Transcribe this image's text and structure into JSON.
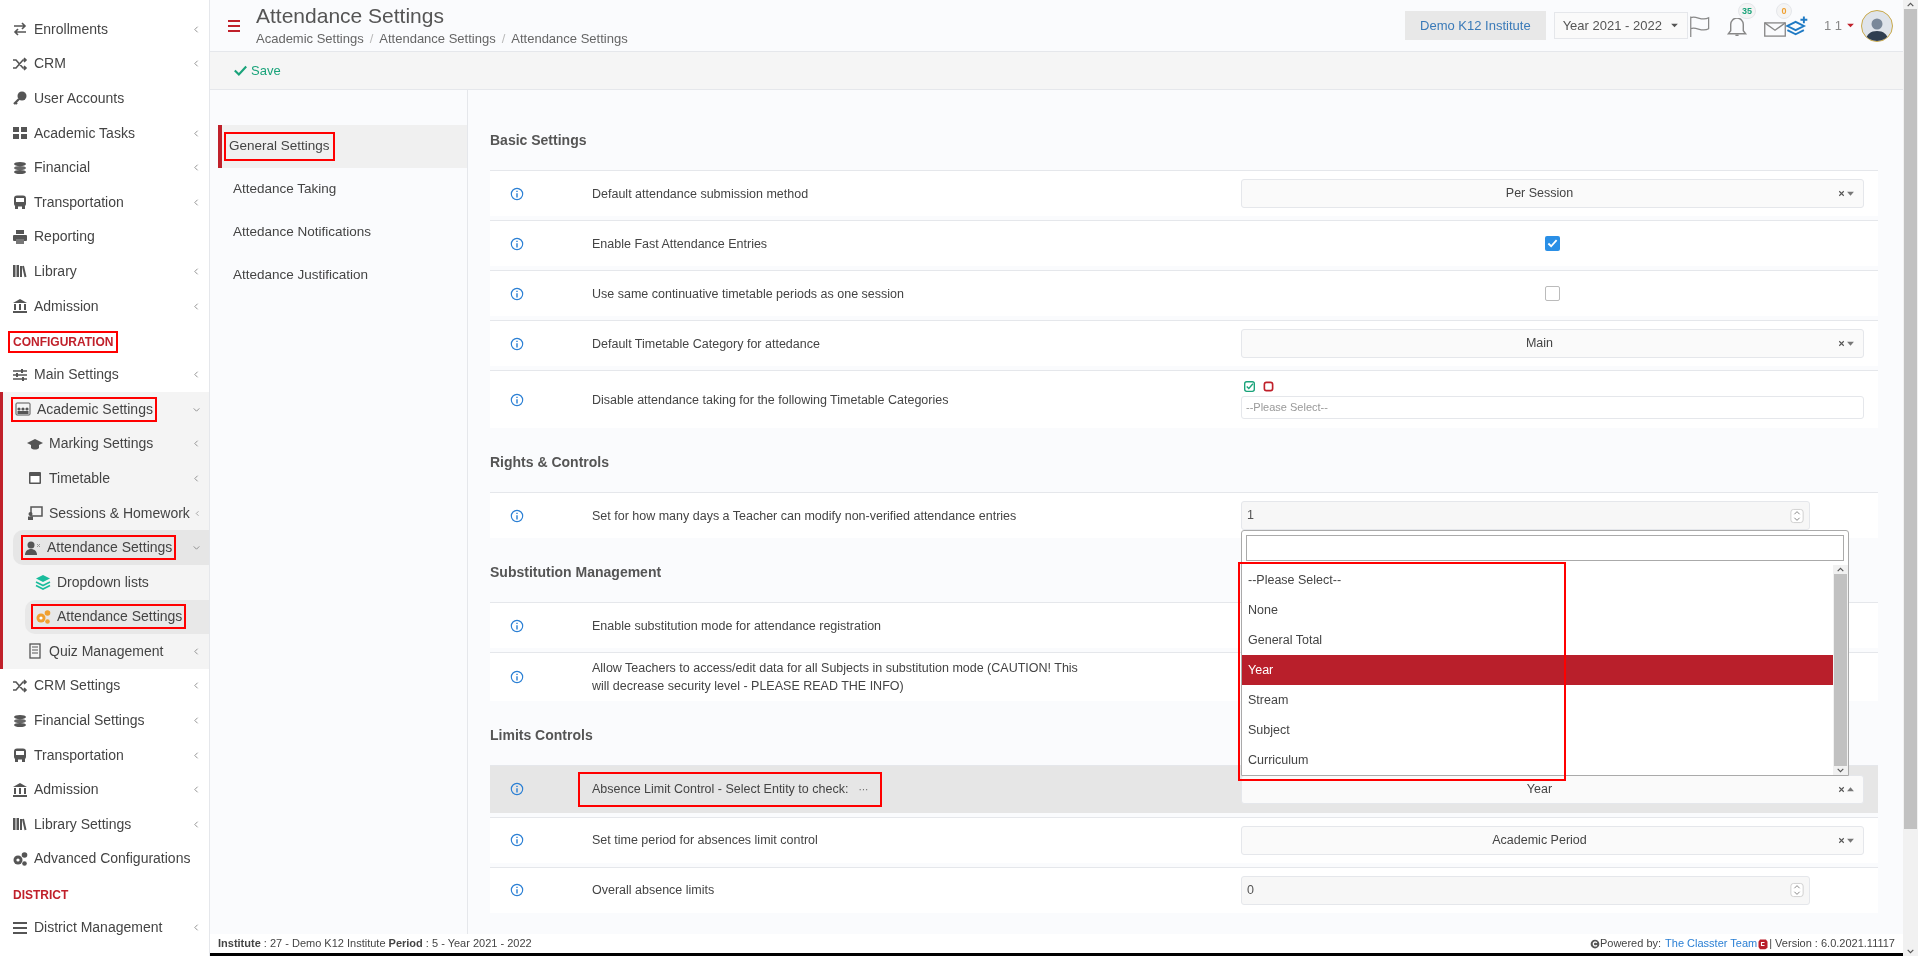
{
  "sidebar": [
    {
      "kind": "item",
      "label": "Enrollments",
      "expanded": false
    },
    {
      "kind": "item",
      "label": "CRM",
      "expanded": false
    },
    {
      "kind": "item",
      "label": "User Accounts"
    },
    {
      "kind": "item",
      "label": "Academic Tasks",
      "expanded": false
    },
    {
      "kind": "item",
      "label": "Financial",
      "expanded": false
    },
    {
      "kind": "item",
      "label": "Transportation",
      "expanded": false
    },
    {
      "kind": "item",
      "label": "Reporting"
    },
    {
      "kind": "item",
      "label": "Library",
      "expanded": false
    },
    {
      "kind": "item",
      "label": "Admission",
      "expanded": false
    },
    {
      "kind": "heading",
      "label": "CONFIGURATION",
      "annotated": true
    },
    {
      "kind": "item",
      "label": "Main Settings",
      "expanded": false
    },
    {
      "kind": "item",
      "label": "Academic Settings",
      "expanded": true,
      "annotated": true,
      "children": [
        {
          "label": "Marking Settings",
          "expanded": false
        },
        {
          "label": "Timetable",
          "expanded": false
        },
        {
          "label": "Sessions & Homework",
          "expanded": false
        },
        {
          "label": "Attendance Settings",
          "expanded": true,
          "annotated": true,
          "children": [
            {
              "label": "Dropdown lists",
              "selected": false,
              "annotated": false
            },
            {
              "label": "Attendance Settings",
              "selected": true,
              "annotated": true
            }
          ]
        },
        {
          "label": "Quiz Management",
          "expanded": false
        }
      ]
    },
    {
      "kind": "item",
      "label": "CRM Settings",
      "expanded": false
    },
    {
      "kind": "item",
      "label": "Financial Settings",
      "expanded": false
    },
    {
      "kind": "item",
      "label": "Transportation",
      "expanded": false
    },
    {
      "kind": "item",
      "label": "Admission",
      "expanded": false
    },
    {
      "kind": "item",
      "label": "Library Settings",
      "expanded": false
    },
    {
      "kind": "item",
      "label": "Advanced Configurations"
    },
    {
      "kind": "heading",
      "label": "DISTRICT",
      "annotated": false
    },
    {
      "kind": "item",
      "label": "District Management",
      "expanded": false
    }
  ],
  "header": {
    "title": "Attendance Settings",
    "breadcrumbs": [
      {
        "kind": "link",
        "text": "Academic Settings"
      },
      {
        "kind": "separator",
        "text": "/"
      },
      {
        "kind": "link",
        "text": "Attendance Settings"
      },
      {
        "kind": "separator",
        "text": "/"
      },
      {
        "kind": "link",
        "text": "Attendance Settings"
      }
    ],
    "institute": "Demo K12 Institute",
    "year": "Year 2021 - 2022",
    "notifications": "35",
    "messages": "0",
    "user": "1 1"
  },
  "toolbar": {
    "save": "Save"
  },
  "tabs": [
    {
      "label": "General Settings",
      "selected": true,
      "annotated": true
    },
    {
      "label": "Attedance Taking",
      "selected": false,
      "annotated": false
    },
    {
      "label": "Attedance Notifications",
      "selected": false,
      "annotated": false
    },
    {
      "label": "Attedance Justification",
      "selected": false,
      "annotated": false
    }
  ],
  "sections": [
    {
      "title": "Basic Settings",
      "rows": [
        {
          "label": "Default attendance submission method",
          "control": {
            "kind": "select",
            "value": "Per Session",
            "open": false
          }
        },
        {
          "label": "Enable Fast Attendance Entries",
          "control": {
            "kind": "checkbox",
            "checked": true
          }
        },
        {
          "label": "Use same continuative timetable periods as one session",
          "control": {
            "kind": "checkbox",
            "checked": false
          }
        },
        {
          "label": "Default Timetable Category for attedance",
          "control": {
            "kind": "select",
            "value": "Main",
            "open": false
          }
        },
        {
          "label": "Disable attendance taking for the following Timetable Categories",
          "control": {
            "kind": "multiselect",
            "placeholder": "--Please Select--"
          }
        }
      ]
    },
    {
      "title": "Rights & Controls",
      "rows": [
        {
          "label": "Set for how many days a Teacher can modify non-verified attendance entries",
          "control": {
            "kind": "number",
            "value": "1"
          }
        }
      ]
    },
    {
      "title": "Substitution Management",
      "rows": [
        {
          "label": "Enable substitution mode for attendance registration"
        },
        {
          "label": "Allow Teachers to access/edit data for all Subjects in substitution mode (CAUTION! This will decrease security level - PLEASE READ THE INFO)"
        }
      ]
    },
    {
      "title": "Limits Controls",
      "rows": [
        {
          "label": "Absence Limit Control - Select Entity to check:",
          "suffix": "···",
          "highlighted": true,
          "annotated": true,
          "control": {
            "kind": "select",
            "value": "Year",
            "open": true
          }
        },
        {
          "label": "Set time period for absences limit control",
          "control": {
            "kind": "select",
            "value": "Academic Period",
            "open": false
          }
        },
        {
          "label": "Overall absence limits",
          "control": {
            "kind": "number",
            "value": "0"
          }
        }
      ]
    }
  ],
  "dropdown": {
    "annotated": true,
    "options": [
      {
        "label": "--Please Select--",
        "selected": false
      },
      {
        "label": "None",
        "selected": false
      },
      {
        "label": "General Total",
        "selected": false
      },
      {
        "label": "Year",
        "selected": true
      },
      {
        "label": "Stream",
        "selected": false
      },
      {
        "label": "Subject",
        "selected": false
      },
      {
        "label": "Curriculum",
        "selected": false
      }
    ]
  },
  "footer": {
    "info": "**Institute** : 27 - Demo K12 Institute **Period** : 5 - Year 2021 - 2022",
    "powered": "Powered by:",
    "team": "The Classter Team",
    "version": "| Version : 6.0.2021.11117"
  }
}
